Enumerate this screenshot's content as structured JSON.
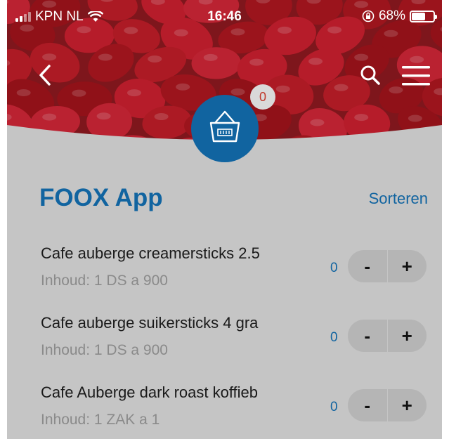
{
  "status_bar": {
    "carrier": "KPN NL",
    "time": "16:46",
    "battery_percent": "68%",
    "battery_level": 0.68
  },
  "header": {
    "back_icon": "chevron-left-icon",
    "search_icon": "search-icon",
    "menu_icon": "hamburger-menu-icon",
    "basket_icon": "shopping-basket-icon",
    "basket_count": "0"
  },
  "main": {
    "title": "FOOX App",
    "sort_label": "Sorteren"
  },
  "products": [
    {
      "name": "Cafe auberge creamersticks 2.5",
      "content": "Inhoud: 1 DS a 900",
      "quantity": "0",
      "minus": "-",
      "plus": "+"
    },
    {
      "name": "Cafe auberge suikersticks 4 gra",
      "content": "Inhoud: 1 DS a 900",
      "quantity": "0",
      "minus": "-",
      "plus": "+"
    },
    {
      "name": "Cafe Auberge dark roast koffieb",
      "content": "Inhoud: 1 ZAK a 1",
      "quantity": "0",
      "minus": "-",
      "plus": "+"
    }
  ],
  "colors": {
    "brand_blue": "#1164a0",
    "panel_grey": "#c5c5c5",
    "badge_text": "#c0392b"
  }
}
